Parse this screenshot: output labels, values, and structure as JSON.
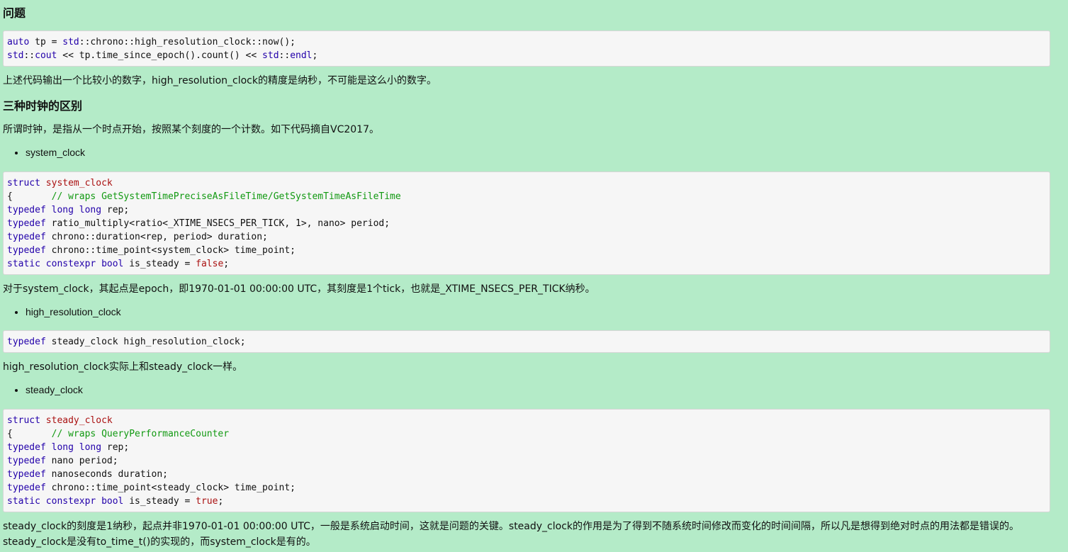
{
  "sections": {
    "problem_title": "问题",
    "problem_code": [
      [
        {
          "t": "auto",
          "c": "kw"
        },
        {
          "t": " tp = "
        },
        {
          "t": "std",
          "c": "ns"
        },
        {
          "t": "::chrono::high_resolution_clock::now();"
        }
      ],
      [
        {
          "t": "std",
          "c": "ns"
        },
        {
          "t": "::"
        },
        {
          "t": "cout",
          "c": "ns"
        },
        {
          "t": " << tp.time_since_epoch().count() << "
        },
        {
          "t": "std",
          "c": "ns"
        },
        {
          "t": "::"
        },
        {
          "t": "endl",
          "c": "ns"
        },
        {
          "t": ";"
        }
      ]
    ],
    "problem_text": "上述代码输出一个比较小的数字，high_resolution_clock的精度是纳秒，不可能是这么小的数字。",
    "diff_title": "三种时钟的区别",
    "diff_intro": "所谓时钟，是指从一个时点开始，按照某个刻度的一个计数。如下代码摘自VC2017。",
    "bullet_system": "system_clock",
    "system_code": [
      [
        {
          "t": "struct",
          "c": "kw"
        },
        {
          "t": " "
        },
        {
          "t": "system_clock",
          "c": "ty"
        }
      ],
      [
        {
          "t": "{       "
        },
        {
          "t": "// wraps GetSystemTimePreciseAsFileTime/GetSystemTimeAsFileTime",
          "c": "cm"
        }
      ],
      [
        {
          "t": "typedef",
          "c": "kw"
        },
        {
          "t": " "
        },
        {
          "t": "long",
          "c": "kw"
        },
        {
          "t": " "
        },
        {
          "t": "long",
          "c": "kw"
        },
        {
          "t": " rep;"
        }
      ],
      [
        {
          "t": "typedef",
          "c": "kw"
        },
        {
          "t": " ratio_multiply<ratio<_XTIME_NSECS_PER_TICK, 1>, nano> period;"
        }
      ],
      [
        {
          "t": "typedef",
          "c": "kw"
        },
        {
          "t": " chrono::duration<rep, period> duration;"
        }
      ],
      [
        {
          "t": "typedef",
          "c": "kw"
        },
        {
          "t": " chrono::time_point<system_clock> time_point;"
        }
      ],
      [
        {
          "t": "static",
          "c": "kw"
        },
        {
          "t": " "
        },
        {
          "t": "constexpr",
          "c": "kw"
        },
        {
          "t": " "
        },
        {
          "t": "bool",
          "c": "kw"
        },
        {
          "t": " is_steady = "
        },
        {
          "t": "false",
          "c": "lit"
        },
        {
          "t": ";"
        }
      ]
    ],
    "system_text": "对于system_clock，其起点是epoch，即1970-01-01 00:00:00 UTC，其刻度是1个tick，也就是_XTIME_NSECS_PER_TICK纳秒。",
    "bullet_hrc": "high_resolution_clock",
    "hrc_code": [
      [
        {
          "t": "typedef",
          "c": "kw"
        },
        {
          "t": " steady_clock high_resolution_clock;"
        }
      ]
    ],
    "hrc_text": "high_resolution_clock实际上和steady_clock一样。",
    "bullet_steady": "steady_clock",
    "steady_code": [
      [
        {
          "t": "struct",
          "c": "kw"
        },
        {
          "t": " "
        },
        {
          "t": "steady_clock",
          "c": "ty"
        }
      ],
      [
        {
          "t": "{       "
        },
        {
          "t": "// wraps QueryPerformanceCounter",
          "c": "cm"
        }
      ],
      [
        {
          "t": "typedef",
          "c": "kw"
        },
        {
          "t": " "
        },
        {
          "t": "long",
          "c": "kw"
        },
        {
          "t": " "
        },
        {
          "t": "long",
          "c": "kw"
        },
        {
          "t": " rep;"
        }
      ],
      [
        {
          "t": "typedef",
          "c": "kw"
        },
        {
          "t": " nano period;"
        }
      ],
      [
        {
          "t": "typedef",
          "c": "kw"
        },
        {
          "t": " nanoseconds duration;"
        }
      ],
      [
        {
          "t": "typedef",
          "c": "kw"
        },
        {
          "t": " chrono::time_point<steady_clock> time_point;"
        }
      ],
      [
        {
          "t": "static",
          "c": "kw"
        },
        {
          "t": " "
        },
        {
          "t": "constexpr",
          "c": "kw"
        },
        {
          "t": " "
        },
        {
          "t": "bool",
          "c": "kw"
        },
        {
          "t": " is_steady = "
        },
        {
          "t": "true",
          "c": "lit"
        },
        {
          "t": ";"
        }
      ]
    ],
    "steady_text_1": "steady_clock的刻度是1纳秒，起点并非1970-01-01 00:00:00 UTC，一般是系统启动时间，这就是问题的关键。steady_clock的作用是为了得到不随系统时间修改而变化的时间间隔，所以凡是想得到绝对时点的用法都是错误的。",
    "steady_text_2": "steady_clock是没有to_time_t()的实现的，而system_clock是有的。"
  },
  "colors": {
    "background": "#b4ebc8",
    "code_background": "#f6f6f6",
    "keyword": "#2200aa",
    "type_name": "#aa1111",
    "comment": "#119911"
  }
}
